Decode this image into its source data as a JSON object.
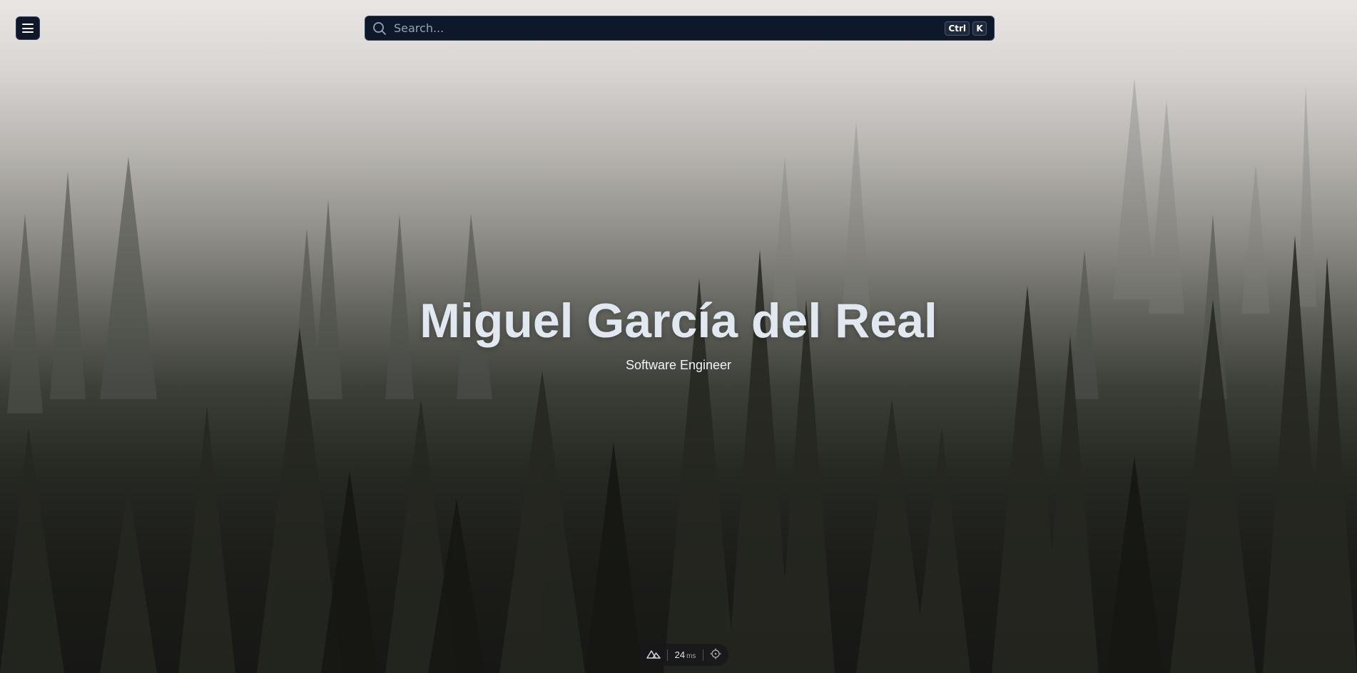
{
  "search": {
    "placeholder": "Search...",
    "shortcut_modifier": "Ctrl",
    "shortcut_key": "K"
  },
  "hero": {
    "title": "Miguel García del Real",
    "subtitle": "Software Engineer"
  },
  "devtools": {
    "render_time": "24",
    "render_unit": "ms"
  },
  "icons": {
    "menu": "hamburger-menu-icon",
    "search": "search-icon",
    "nuxt": "nuxt-logo-icon",
    "inspect": "crosshair-icon"
  },
  "colors": {
    "surface": "#0f172a",
    "border": "#334155",
    "title": "#e2e8f0",
    "placeholder": "#94a3b8"
  }
}
